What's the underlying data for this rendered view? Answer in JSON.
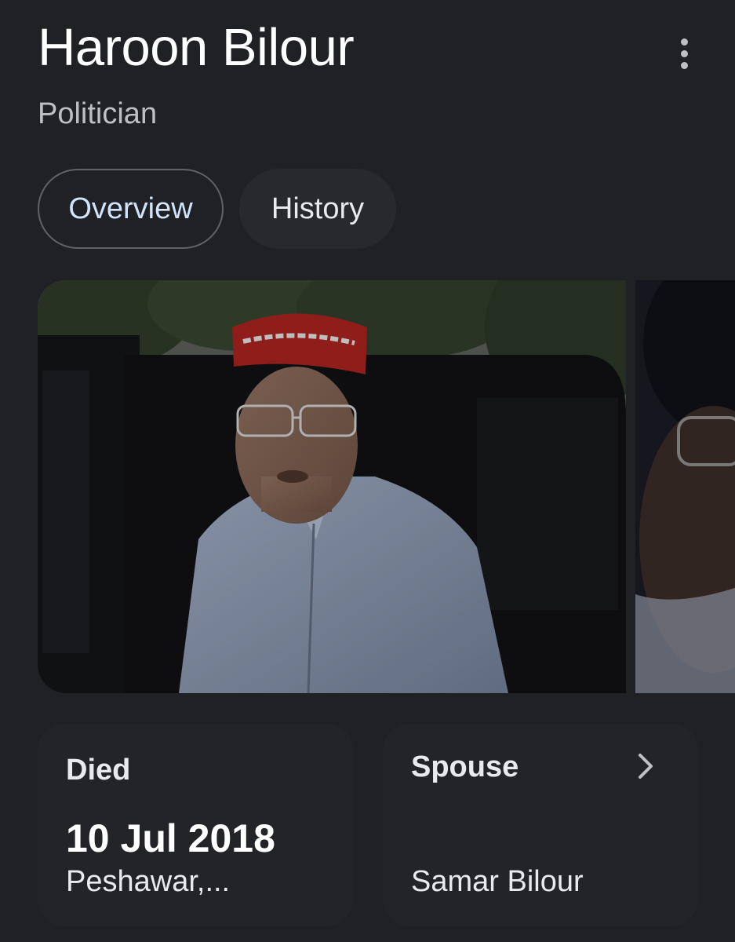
{
  "header": {
    "title": "Haroon Bilour",
    "subtitle": "Politician",
    "more_icon": "more-vert-icon"
  },
  "tabs": [
    {
      "label": "Overview",
      "selected": true
    },
    {
      "label": "History",
      "selected": false
    }
  ],
  "images": [
    {
      "description": "man-in-red-cap-and-light-blue-shirt-beside-black-vehicle"
    },
    {
      "description": "partial-second-photo"
    }
  ],
  "facts": {
    "died": {
      "label": "Died",
      "date": "10 Jul 2018",
      "place": "Peshawar,..."
    },
    "spouse": {
      "label": "Spouse",
      "name": "Samar Bilour",
      "icon": "chevron-right-icon"
    }
  },
  "colors": {
    "background": "#202124",
    "selected_tab_text": "#d2e3fc",
    "card_background": "#232427"
  }
}
